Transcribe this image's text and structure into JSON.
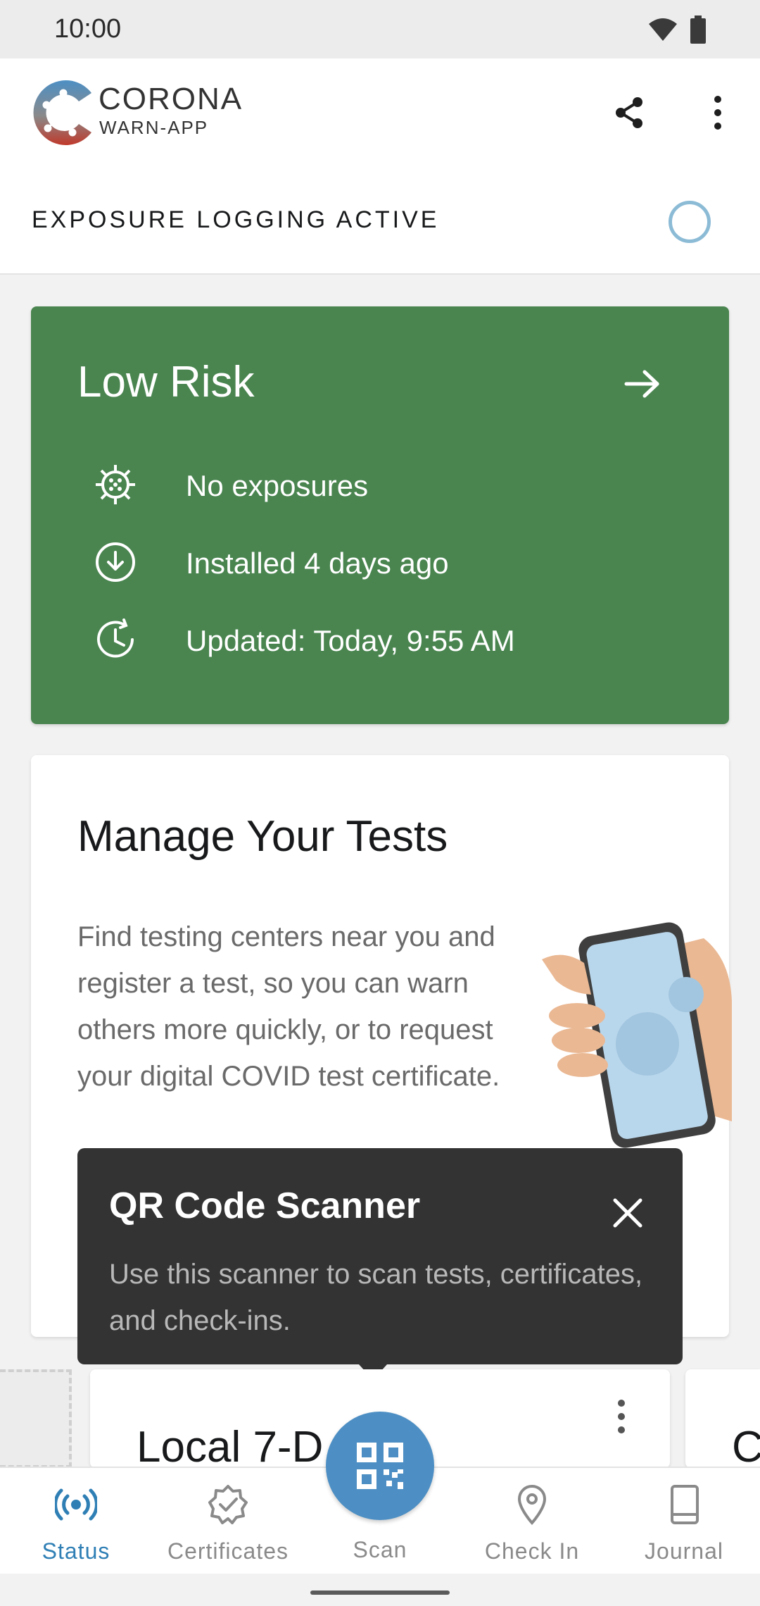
{
  "status_bar": {
    "time": "10:00"
  },
  "app": {
    "logo_title": "CORONA",
    "logo_sub": "WARN-APP"
  },
  "exposure": {
    "label": "EXPOSURE LOGGING ACTIVE"
  },
  "risk_card": {
    "title": "Low Risk",
    "rows": [
      {
        "icon": "virus-icon",
        "text": "No exposures"
      },
      {
        "icon": "download-circle-icon",
        "text": "Installed 4 days ago"
      },
      {
        "icon": "clock-refresh-icon",
        "text": "Updated: Today, 9:55 AM"
      }
    ],
    "color": "#4a8550"
  },
  "tests_card": {
    "title": "Manage Your Tests",
    "body": "Find testing centers near you and register a test, so you can warn others more quickly, or to request your digital COVID test certificate."
  },
  "tooltip": {
    "title": "QR Code Scanner",
    "body": "Use this scanner to scan tests, certificates, and check-ins."
  },
  "incidence_card": {
    "title": "Local 7-D"
  },
  "next_card": {
    "letter": "C"
  },
  "nav": {
    "items": [
      {
        "label": "Status",
        "icon": "broadcast-icon",
        "active": true
      },
      {
        "label": "Certificates",
        "icon": "certificate-badge-icon",
        "active": false
      },
      {
        "label": "Scan",
        "icon": "qr-code-icon",
        "active": false
      },
      {
        "label": "Check In",
        "icon": "location-pin-icon",
        "active": false
      },
      {
        "label": "Journal",
        "icon": "book-icon",
        "active": false
      }
    ]
  },
  "colors": {
    "accent": "#2f7fb5",
    "fab": "#4d8fc4",
    "tooltip_bg": "#333333"
  }
}
